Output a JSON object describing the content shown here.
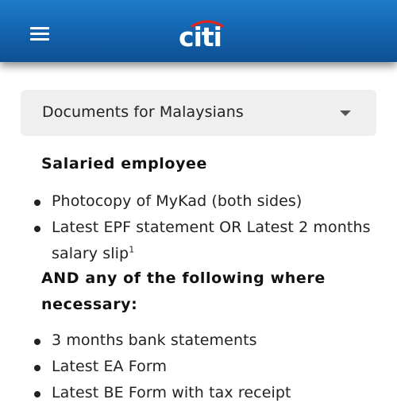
{
  "header": {
    "menu_icon": "hamburger-menu-icon",
    "logo_text": "citi",
    "brand_color": "#1466b1",
    "logo_arc_color": "#e3241b"
  },
  "dropdown": {
    "selected": "Documents for Malaysians",
    "caret_icon": "caret-down-icon"
  },
  "sections": {
    "salaried_heading": "Salaried employee",
    "salaried_items": [
      "Photocopy of MyKad (both sides)",
      "Latest EPF statement OR Latest 2 months salary slip"
    ],
    "footnote_marker": "1",
    "optional_heading": "AND any of the following where necessary:",
    "optional_items": [
      "3 months bank statements",
      "Latest EA Form",
      "Latest BE Form with tax receipt"
    ]
  }
}
